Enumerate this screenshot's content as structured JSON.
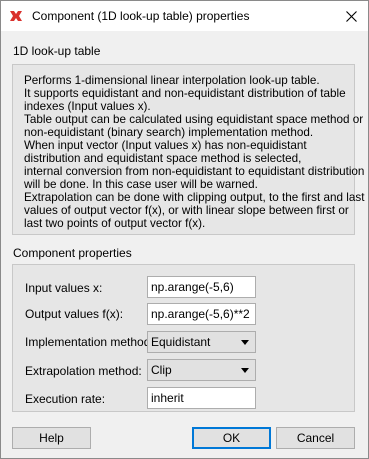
{
  "window": {
    "title": "Component (1D look-up table) properties",
    "close_icon": "close-icon",
    "app_icon": "app-icon"
  },
  "description_group": {
    "label": "1D look-up table",
    "lines": [
      "Performs 1-dimensional linear interpolation look-up table.",
      "It supports equidistant and non-equidistant distribution of table",
      "indexes (Input values x).",
      "Table output can be calculated using equidistant space method or",
      "non-equidistant (binary search) implementation method.",
      "When input vector (Input values x) has non-equidistant",
      "distribution and equidistant space method is selected,",
      "internal conversion from non-equidistant to equidistant distribution",
      "will be done. In this case user will be warned.",
      "Extrapolation can be done with clipping output, to the first and last",
      "values of output vector f(x), or with linear slope between first or",
      "last two points of output vector f(x)."
    ]
  },
  "properties_group": {
    "label": "Component properties",
    "input_values": {
      "label": "Input values x:",
      "value": "np.arange(-5,6)"
    },
    "output_values": {
      "label": "Output values f(x):",
      "value": "np.arange(-5,6)**2"
    },
    "implementation": {
      "label": "Implementation method:",
      "value": "Equidistant"
    },
    "extrapolation": {
      "label": "Extrapolation method:",
      "value": "Clip"
    },
    "execution_rate": {
      "label": "Execution rate:",
      "value": "inherit"
    }
  },
  "buttons": {
    "help": "Help",
    "ok": "OK",
    "cancel": "Cancel"
  },
  "colors": {
    "accent": "#0078d7",
    "app_icon": "#d9302c"
  }
}
